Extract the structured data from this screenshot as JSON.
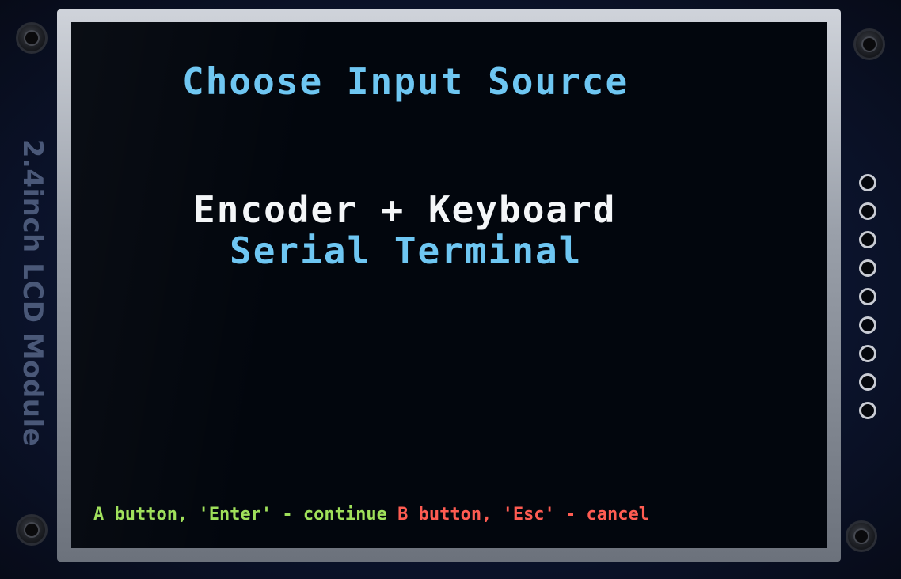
{
  "module": {
    "label": "2.4inch LCD Module"
  },
  "screen": {
    "title": "Choose Input Source",
    "options": [
      {
        "label": "Encoder + Keyboard",
        "selected": true
      },
      {
        "label": "Serial Terminal",
        "selected": false
      }
    ],
    "footer": {
      "continue_hint": "A button, 'Enter' - continue",
      "cancel_hint": "B button, 'Esc' - cancel"
    }
  },
  "colors": {
    "title": "#6ec6f2",
    "selected_option": "#f4f6f8",
    "option": "#6ec6f2",
    "continue_hint": "#9fe05a",
    "cancel_hint": "#ff5c52",
    "background": "#02060d"
  }
}
